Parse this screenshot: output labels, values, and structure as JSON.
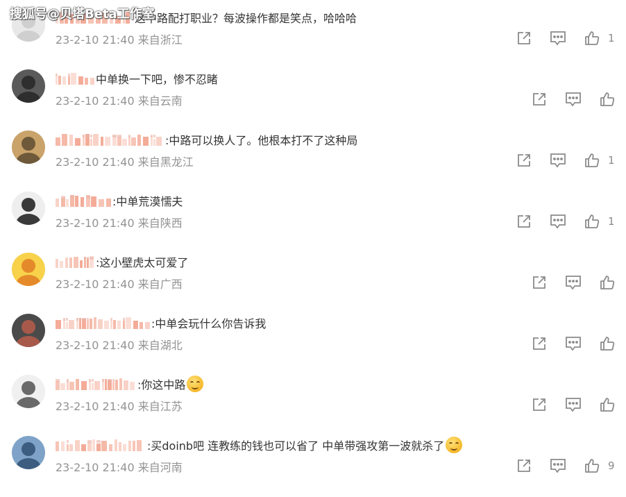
{
  "watermark": "搜狐号@贝塔Beta工作室",
  "comments": [
    {
      "text": "这中路配打职业？每波操作都是笑点，哈哈哈",
      "time": "23-2-10 21:40",
      "location": "来自浙江",
      "likes": "1"
    },
    {
      "text": "中单换一下吧，惨不忍睹",
      "time": "23-2-10 21:40",
      "location": "来自云南",
      "likes": ""
    },
    {
      "text": ":中路可以换人了。他根本打不了这种局",
      "time": "23-2-10 21:40",
      "location": "来自黑龙江",
      "likes": "1"
    },
    {
      "text": ":中单荒漠懦夫",
      "time": "23-2-10 21:40",
      "location": "来自陕西",
      "likes": "1"
    },
    {
      "text": ":这小壁虎太可爱了",
      "time": "23-2-10 21:40",
      "location": "来自广西",
      "likes": ""
    },
    {
      "text": ":中单会玩什么你告诉我",
      "time": "23-2-10 21:40",
      "location": "来自湖北",
      "likes": ""
    },
    {
      "text": ":你这中路",
      "time": "23-2-10 21:40",
      "location": "来自江苏",
      "likes": "",
      "emoji": "smile-emoji"
    },
    {
      "text": ":买doinb吧  连教练的钱也可以省了  中单带强攻第一波就杀了",
      "time": "23-2-10 21:40",
      "location": "来自河南",
      "likes": "9",
      "emoji": "blush-emoji"
    }
  ],
  "icons": {
    "share": "share-icon",
    "reply": "comment-icon",
    "like": "thumbs-up-icon"
  },
  "colors": {
    "text": "#333333",
    "meta": "#939393",
    "icon": "#8a8a8a",
    "pixelated_name": "#f2a08a"
  }
}
